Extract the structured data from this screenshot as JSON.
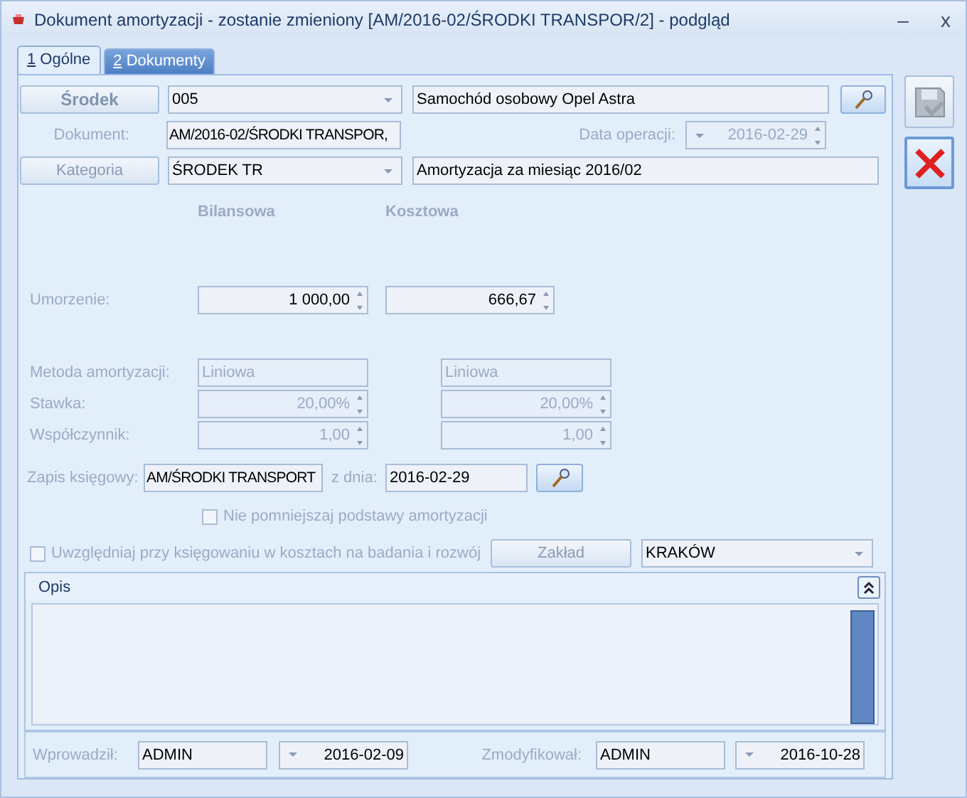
{
  "window": {
    "title": "Dokument amortyzacji - zostanie zmieniony [AM/2016-02/ŚRODKI TRANSPOR/2] - podgląd",
    "minimize": "–",
    "close": "x"
  },
  "tabs": [
    {
      "mnemonic": "1",
      "label": "Ogólne",
      "selected": true
    },
    {
      "mnemonic": "2",
      "label": "Dokumenty",
      "selected": false
    }
  ],
  "srodek": {
    "button": "Środek",
    "code": "005",
    "name": "Samochód osobowy Opel Astra"
  },
  "dokument": {
    "label": "Dokument:",
    "value": "AM/2016-02/ŚRODKI TRANSPOR,",
    "date_label": "Data operacji:",
    "date": "2016-02-29"
  },
  "kategoria": {
    "button": "Kategoria",
    "code": "ŚRODEK TR",
    "description": "Amortyzacja za miesiąc 2016/02"
  },
  "columns": [
    "Bilansowa",
    "Kosztowa"
  ],
  "umorzenie": {
    "label": "Umorzenie:",
    "values": [
      "1 000,00",
      "666,67"
    ]
  },
  "metoda": {
    "label": "Metoda amortyzacji:",
    "values": [
      "Liniowa",
      "Liniowa"
    ]
  },
  "stawka": {
    "label": "Stawka:",
    "values": [
      "20,00%",
      "20,00%"
    ]
  },
  "wspolczynnik": {
    "label": "Współczynnik:",
    "values": [
      "1,00",
      "1,00"
    ]
  },
  "zapis": {
    "label": "Zapis księgowy:",
    "value": "AM/ŚRODKI TRANSPORT",
    "date_label": "z dnia:",
    "date": "2016-02-29"
  },
  "checkboxes": [
    {
      "label": "Nie pomniejszaj podstawy amortyzacji",
      "checked": false
    },
    {
      "label": "Uwzględniaj przy księgowaniu w kosztach na badania i rozwój",
      "checked": false
    }
  ],
  "zaklad": {
    "button": "Zakład",
    "value": "KRAKÓW"
  },
  "opis": {
    "title": "Opis"
  },
  "footer": {
    "created_label": "Wprowadził:",
    "created_by": "ADMIN",
    "created_date": "2016-02-09",
    "modified_label": "Zmodyfikował:",
    "modified_by": "ADMIN",
    "modified_date": "2016-10-28"
  }
}
